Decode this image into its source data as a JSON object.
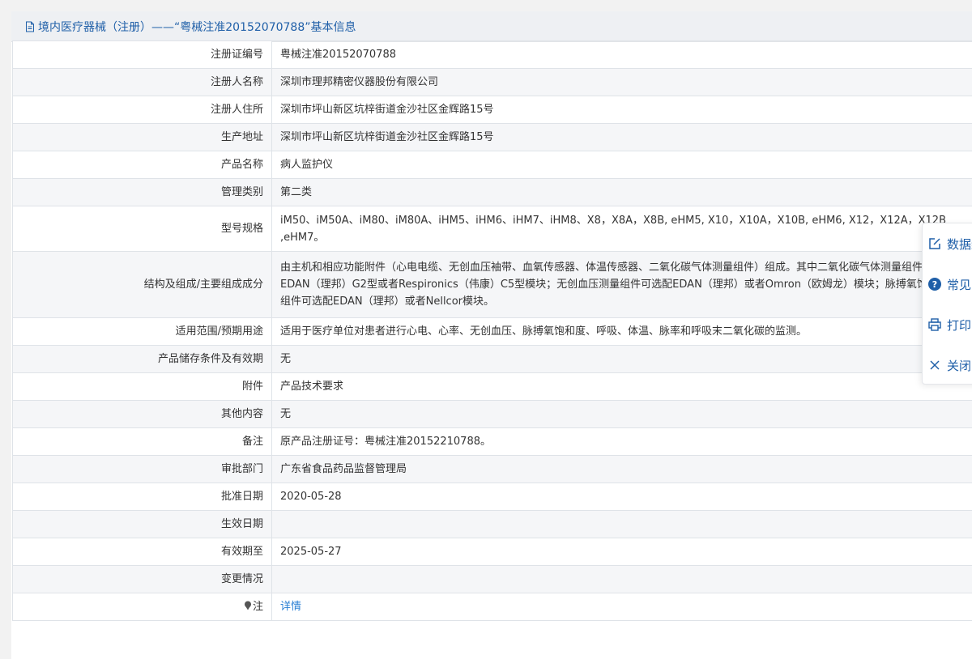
{
  "header": {
    "title": "境内医疗器械（注册）——“粤械注准20152070788”基本信息"
  },
  "rows": [
    {
      "label": "注册证编号",
      "value": "粤械注准20152070788"
    },
    {
      "label": "注册人名称",
      "value": "深圳市理邦精密仪器股份有限公司"
    },
    {
      "label": "注册人住所",
      "value": "深圳市坪山新区坑梓街道金沙社区金辉路15号"
    },
    {
      "label": "生产地址",
      "value": "深圳市坪山新区坑梓街道金沙社区金辉路15号"
    },
    {
      "label": "产品名称",
      "value": "病人监护仪"
    },
    {
      "label": "管理类别",
      "value": "第二类"
    },
    {
      "label": "型号规格",
      "value": "iM50、iM50A、iM80、iM80A、iHM5、iHM6、iHM7、iHM8、X8，X8A，X8B, eHM5, X10，X10A，X10B, eHM6, X12，X12A，X12B ,eHM7。"
    },
    {
      "label": "结构及组成/主要组成成分",
      "value": "由主机和相应功能附件（心电电缆、无创血压袖带、血氧传感器、体温传感器、二氧化碳气体测量组件）组成。其中二氧化碳气体测量组件可选配EDAN（理邦）G2型或者Respironics（伟康）C5型模块；无创血压测量组件可选配EDAN（理邦）或者Omron（欧姆龙）模块；脉搏氧饱和度测量组件可选配EDAN（理邦）或者Nellcor模块。"
    },
    {
      "label": "适用范围/预期用途",
      "value": "适用于医疗单位对患者进行心电、心率、无创血压、脉搏氧饱和度、呼吸、体温、脉率和呼吸末二氧化碳的监测。"
    },
    {
      "label": "产品储存条件及有效期",
      "value": "无"
    },
    {
      "label": "附件",
      "value": "产品技术要求"
    },
    {
      "label": "其他内容",
      "value": "无"
    },
    {
      "label": "备注",
      "value": "原产品注册证号：粤械注准20152210788。"
    },
    {
      "label": "审批部门",
      "value": "广东省食品药品监督管理局"
    },
    {
      "label": "批准日期",
      "value": "2020-05-28"
    },
    {
      "label": "生效日期",
      "value": ""
    },
    {
      "label": "有效期至",
      "value": "2025-05-27"
    },
    {
      "label": "变更情况",
      "value": ""
    },
    {
      "label": "注",
      "value": "详情"
    }
  ],
  "float_menu": {
    "items": [
      {
        "label": "数据纠错",
        "icon": "edit-icon"
      },
      {
        "label": "常见问题",
        "icon": "help-icon"
      },
      {
        "label": "打印",
        "icon": "print-icon"
      },
      {
        "label": "关闭",
        "icon": "close-icon"
      }
    ]
  },
  "colors": {
    "accent": "#1f5fa8",
    "link": "#2a7fd4",
    "header_bg": "#eef0f3",
    "alt_row": "#f5f6f8",
    "border": "#dfe3e8"
  }
}
